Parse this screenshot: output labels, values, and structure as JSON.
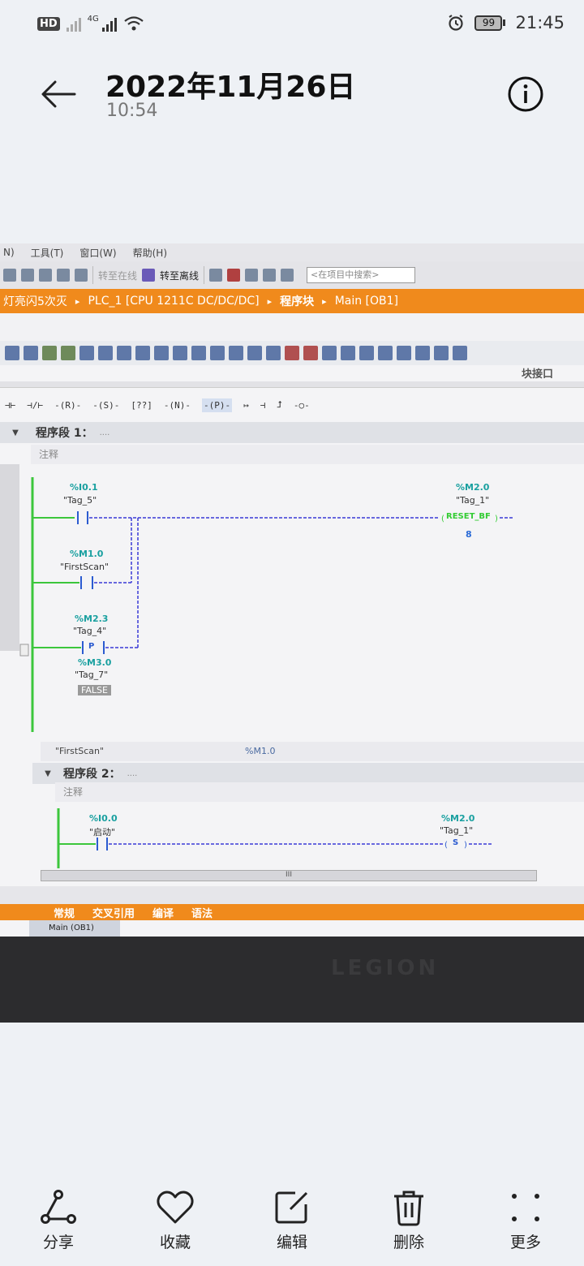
{
  "status_bar": {
    "time": "21:45",
    "battery": "99",
    "hd_label": "HD",
    "network": "4G"
  },
  "header": {
    "title": "2022年11月26日",
    "subtitle": "10:54"
  },
  "photo": {
    "menu": [
      "N)",
      "工具(T)",
      "窗口(W)",
      "帮助(H)"
    ],
    "toolbar_text": {
      "offline_online": "转至在线",
      "to_offline": "转至离线",
      "search_placeholder": "<在项目中搜索>"
    },
    "breadcrumb": [
      "灯亮闪5次灭",
      "PLC_1 [CPU 1211C DC/DC/DC]",
      "程序块",
      "Main [OB1]"
    ],
    "panel_label": "块接口",
    "ladder_toolbar": [
      "⊣⊢",
      "⊣/⊢",
      "-(R)-",
      "-(S)-",
      "[??]",
      "-(N)-",
      "-(P)-",
      "↦",
      "⊣",
      "⮥",
      "-○-"
    ],
    "network1": {
      "label": "程序段 1：",
      "dots": "....",
      "comment": "注释",
      "contacts": [
        {
          "addr": "%I0.1",
          "tag": "\"Tag_5\""
        },
        {
          "addr": "%M1.0",
          "tag": "\"FirstScan\""
        },
        {
          "addr": "%M2.3",
          "tag": "\"Tag_4\""
        },
        {
          "addr": "%M3.0",
          "tag": "\"Tag_7\"",
          "value": "FALSE"
        }
      ],
      "coil": {
        "addr": "%M2.0",
        "tag": "\"Tag_1\"",
        "label": "RESET_BF",
        "count": "8"
      },
      "pcontact_label": "P",
      "footer": {
        "tag": "\"FirstScan\"",
        "addr": "%M1.0"
      }
    },
    "network2": {
      "label": "程序段 2：",
      "dots": "....",
      "comment": "注释",
      "contact": {
        "addr": "%I0.0",
        "tag": "\"启动\""
      },
      "coil": {
        "addr": "%M2.0",
        "tag": "\"Tag_1\"",
        "label": "S"
      }
    },
    "scroll_label": "III",
    "bottom_tabs": [
      "常规",
      "交叉引用",
      "编译",
      "语法"
    ],
    "editor_tab": "Main (OB1)",
    "bezel_brand": "LEGION"
  },
  "actions": [
    {
      "label": "分享",
      "icon": "share-icon"
    },
    {
      "label": "收藏",
      "icon": "heart-icon"
    },
    {
      "label": "编辑",
      "icon": "edit-icon"
    },
    {
      "label": "删除",
      "icon": "trash-icon"
    },
    {
      "label": "更多",
      "icon": "more-icon"
    }
  ]
}
